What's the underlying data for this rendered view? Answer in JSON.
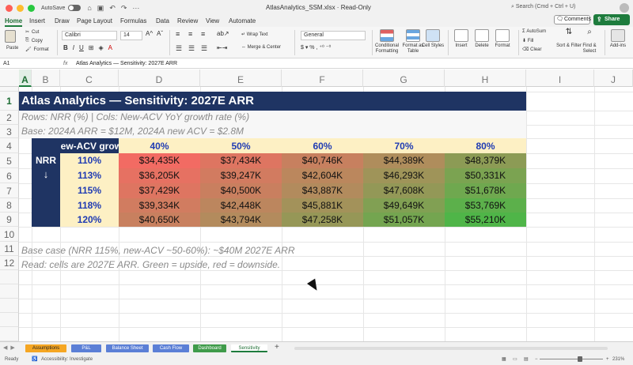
{
  "window": {
    "autosave_label": "AutoSave",
    "filename": "AtlasAnalytics_SSM.xlsx · Read-Only",
    "search_placeholder": "Search (Cmd + Ctrl + U)"
  },
  "ribbon_tabs": [
    "Home",
    "Insert",
    "Draw",
    "Page Layout",
    "Formulas",
    "Data",
    "Review",
    "View",
    "Automate"
  ],
  "ribbon": {
    "comments_label": "Comments",
    "share_label": "Share",
    "paste_label": "Paste",
    "cut_label": "Cut",
    "copy_label": "Copy",
    "format_label": "Format",
    "font_name": "Calibri",
    "font_size": "14",
    "wrap_text_label": "Wrap Text",
    "merge_label": "Merge & Center",
    "number_format": "General",
    "conditional_formatting_label": "Conditional Formatting",
    "format_as_table_label": "Format as Table",
    "cell_styles_label": "Cell Styles",
    "insert_label": "Insert",
    "delete_label": "Delete",
    "format_cells_label": "Format",
    "autosum_label": "AutoSum",
    "fill_label": "Fill",
    "clear_label": "Clear",
    "sort_filter_label": "Sort & Filter",
    "find_select_label": "Find & Select",
    "addins_label": "Add-ins"
  },
  "formula_bar": {
    "name_box": "A1",
    "fx": "fx",
    "content": "Atlas Analytics — Sensitivity: 2027E ARR"
  },
  "columns": [
    "A",
    "B",
    "C",
    "D",
    "E",
    "F",
    "G",
    "H",
    "I",
    "J"
  ],
  "rows": [
    "1",
    "2",
    "3",
    "4",
    "5",
    "6",
    "7",
    "8",
    "9",
    "10",
    "11",
    "12"
  ],
  "sheet": {
    "title": "Atlas Analytics — Sensitivity: 2027E ARR",
    "note_rows": "Rows: NRR (%) | Cols: New-ACV YoY growth rate (%)",
    "note_base": "Base: 2024A ARR = $12M, 2024A new ACV = $2.8M",
    "corner_header": "New-ACV growth",
    "row_axis_label": "NRR",
    "row_axis_arrow": "↓",
    "col_headers": [
      "40%",
      "50%",
      "60%",
      "70%",
      "80%"
    ],
    "row_headers": [
      "110%",
      "113%",
      "115%",
      "118%",
      "120%"
    ],
    "values": [
      [
        "$34,435K",
        "$37,434K",
        "$40,746K",
        "$44,389K",
        "$48,379K"
      ],
      [
        "$36,205K",
        "$39,247K",
        "$42,604K",
        "$46,293K",
        "$50,331K"
      ],
      [
        "$37,429K",
        "$40,500K",
        "$43,887K",
        "$47,608K",
        "$51,678K"
      ],
      [
        "$39,334K",
        "$42,448K",
        "$45,881K",
        "$49,649K",
        "$53,769K"
      ],
      [
        "$40,650K",
        "$43,794K",
        "$47,258K",
        "$51,057K",
        "$55,210K"
      ]
    ],
    "note_basecase": "Base case (NRR 115%, new-ACV ~50-60%): ~$40M 2027E ARR",
    "note_read": "Read: cells are 2027E ARR. Green = upside, red = downside."
  },
  "sheet_tabs": [
    {
      "label": "Assumptions",
      "color": "#f5a623"
    },
    {
      "label": "P&L",
      "color": "#5b7fd6"
    },
    {
      "label": "Balance Sheet",
      "color": "#5b7fd6"
    },
    {
      "label": "Cash Flow",
      "color": "#5b7fd6"
    },
    {
      "label": "Dashboard",
      "color": "#3f9b4a"
    },
    {
      "label": "Sensitivity",
      "color": "#ffffff"
    }
  ],
  "status": {
    "ready": "Ready",
    "accessibility": "Accessibility: Investigate",
    "zoom": "231%"
  },
  "colors": {
    "navy": "#1f3463",
    "header_fill": "#fdf0c4",
    "header_text": "#1f3bb3",
    "heat_red": "#f26b63",
    "heat_green": "#4fb548",
    "excel_green": "#1e7c3d"
  }
}
